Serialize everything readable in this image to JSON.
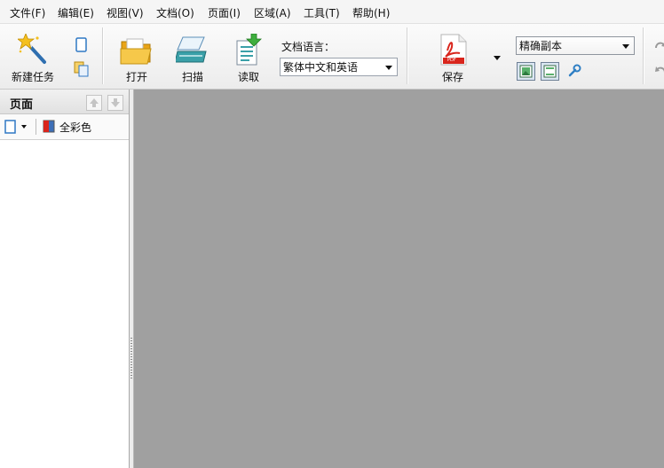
{
  "menu": [
    {
      "label": "文件(F)",
      "name": "menu-file"
    },
    {
      "label": "编辑(E)",
      "name": "menu-edit"
    },
    {
      "label": "视图(V)",
      "name": "menu-view"
    },
    {
      "label": "文档(O)",
      "name": "menu-document"
    },
    {
      "label": "页面(I)",
      "name": "menu-page"
    },
    {
      "label": "区域(A)",
      "name": "menu-area"
    },
    {
      "label": "工具(T)",
      "name": "menu-tools"
    },
    {
      "label": "帮助(H)",
      "name": "menu-help"
    }
  ],
  "toolbar": {
    "new_task": "新建任务",
    "open": "打开",
    "scan": "扫描",
    "read": "读取",
    "language_label": "文档语言：",
    "language_value": "繁体中文和英语",
    "save": "保存",
    "pdf_badge": "PDF",
    "save_mode_value": "精确副本"
  },
  "panel": {
    "title": "页面",
    "color_mode": "全彩色"
  },
  "colors": {
    "workspace": "#a0a0a0",
    "pdf_red": "#d9251c",
    "folder_yellow": "#f2b827",
    "scanner_teal": "#3aa0a8"
  }
}
